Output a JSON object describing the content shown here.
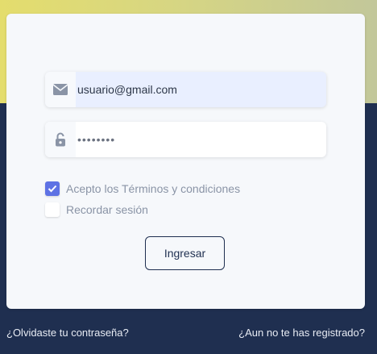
{
  "form": {
    "email_value": "usuario@gmail.com",
    "password_value": "••••••••",
    "terms_label": "Acepto los Términos y condiciones",
    "terms_checked": true,
    "remember_label": "Recordar sesión",
    "remember_checked": false,
    "submit_label": "Ingresar"
  },
  "links": {
    "forgot_password": "¿Olvidaste tu contraseña?",
    "register": "¿Aun no te has registrado?"
  },
  "icons": {
    "email": "envelope-icon",
    "password": "unlock-icon",
    "check": "checkmark-icon"
  },
  "colors": {
    "accent": "#5e72e4",
    "navy": "#1f2f50",
    "gradient_start": "#e4dd6d",
    "gradient_end": "#c2c79a"
  }
}
